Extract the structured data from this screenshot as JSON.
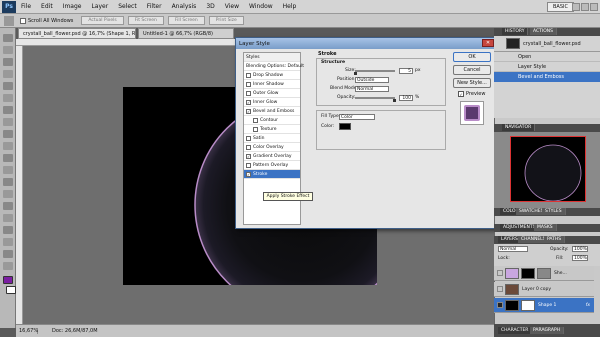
{
  "menubar": {
    "logo": "Ps",
    "items": [
      "File",
      "Edit",
      "Image",
      "Layer",
      "Select",
      "Filter",
      "Analysis",
      "3D",
      "View",
      "Window",
      "Help"
    ],
    "workspace": "BASIC"
  },
  "options_bar": {
    "scroll_all": "Scroll All Windows",
    "buttons": [
      "Actual Pixels",
      "Fit Screen",
      "Fill Screen",
      "Print Size"
    ]
  },
  "document_tabs": [
    "crystall_ball_flower.psd @ 16,7% (Shape 1, RGB/8#) *",
    "Untitled-1 @ 66,7% (RGB/8)"
  ],
  "status": {
    "zoom": "16,67%",
    "doc": "Doc: 26,6M/87,0M"
  },
  "dialog": {
    "title": "Layer Style",
    "styles_header": "Styles",
    "blending": "Blending Options: Default",
    "styles": [
      {
        "label": "Drop Shadow",
        "checked": false
      },
      {
        "label": "Inner Shadow",
        "checked": false
      },
      {
        "label": "Outer Glow",
        "checked": false
      },
      {
        "label": "Inner Glow",
        "checked": true
      },
      {
        "label": "Bevel and Emboss",
        "checked": true
      },
      {
        "label": "Contour",
        "checked": false
      },
      {
        "label": "Texture",
        "checked": false
      },
      {
        "label": "Satin",
        "checked": false
      },
      {
        "label": "Color Overlay",
        "checked": false
      },
      {
        "label": "Gradient Overlay",
        "checked": true
      },
      {
        "label": "Pattern Overlay",
        "checked": false
      },
      {
        "label": "Stroke",
        "checked": true
      }
    ],
    "section_title": "Stroke",
    "structure": "Structure",
    "size_label": "Size:",
    "size_value": "5",
    "size_unit": "px",
    "position_label": "Position:",
    "position_value": "Outside",
    "blend_label": "Blend Mode:",
    "blend_value": "Normal",
    "opacity_label": "Opacity:",
    "opacity_value": "100",
    "opacity_unit": "%",
    "fill_type_label": "Fill Type:",
    "fill_type_value": "Color",
    "color_label": "Color:",
    "buttons": {
      "ok": "OK",
      "cancel": "Cancel",
      "new_style": "New Style...",
      "preview": "Preview"
    },
    "tooltip": "Apply Stroke Effect"
  },
  "history_panel": {
    "tabs": [
      "HISTORY",
      "ACTIONS"
    ],
    "file": "crystall_ball_flower.psd",
    "items": [
      "Open",
      "Layer Style",
      "Bevel and Emboss"
    ]
  },
  "navigator_panel": {
    "tabs": [
      "NAVIGATOR"
    ]
  },
  "color_panel": {
    "tabs": [
      "COLOR",
      "SWATCHES",
      "STYLES"
    ]
  },
  "adjust_panel": {
    "tabs": [
      "ADJUSTMENTS",
      "MASKS"
    ]
  },
  "layers_panel": {
    "tabs": [
      "LAYERS",
      "CHANNELS",
      "PATHS"
    ],
    "blend": "Normal",
    "opacity_label": "Opacity:",
    "opacity": "100%",
    "lock_label": "Lock:",
    "fill_label": "Fill:",
    "fill": "100%",
    "layers": [
      {
        "name": "She...",
        "fx": ""
      },
      {
        "name": "Layer 0 copy",
        "fx": ""
      },
      {
        "name": "Shape 1",
        "fx": "fx"
      }
    ]
  },
  "bottom_tabs": [
    "CHARACTER",
    "PARAGRAPH"
  ],
  "colors": {
    "foreground": "#7b1fa2",
    "accent": "#3b73c4"
  }
}
